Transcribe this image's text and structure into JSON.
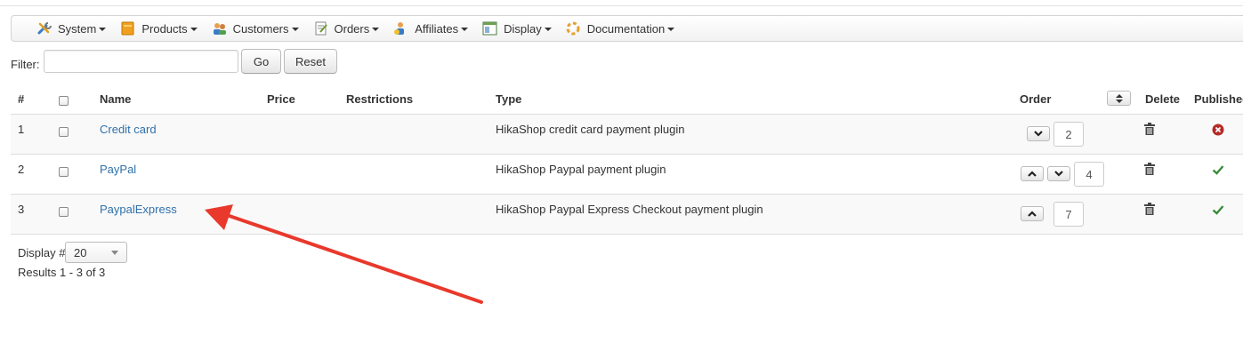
{
  "menu": {
    "items": [
      {
        "label": "System",
        "icon": "tools-icon"
      },
      {
        "label": "Products",
        "icon": "products-icon"
      },
      {
        "label": "Customers",
        "icon": "customers-icon"
      },
      {
        "label": "Orders",
        "icon": "orders-icon"
      },
      {
        "label": "Affiliates",
        "icon": "affiliates-icon"
      },
      {
        "label": "Display",
        "icon": "display-icon"
      },
      {
        "label": "Documentation",
        "icon": "documentation-icon"
      }
    ]
  },
  "filter": {
    "label": "Filter:",
    "value": "",
    "go_label": "Go",
    "reset_label": "Reset"
  },
  "table": {
    "headers": {
      "num": "#",
      "name": "Name",
      "price": "Price",
      "restrictions": "Restrictions",
      "type": "Type",
      "order": "Order",
      "delete": "Delete",
      "published": "Published"
    },
    "rows": [
      {
        "num": "1",
        "name": "Credit card",
        "price": "",
        "restrictions": "",
        "type": "HikaShop credit card payment plugin",
        "order": "2",
        "published": false,
        "up": false,
        "down": true
      },
      {
        "num": "2",
        "name": "PayPal",
        "price": "",
        "restrictions": "",
        "type": "HikaShop Paypal payment plugin",
        "order": "4",
        "published": true,
        "up": true,
        "down": true
      },
      {
        "num": "3",
        "name": "PaypalExpress",
        "price": "",
        "restrictions": "",
        "type": "HikaShop Paypal Express Checkout payment plugin",
        "order": "7",
        "published": true,
        "up": true,
        "down": false
      }
    ]
  },
  "pagination": {
    "display_label": "Display #",
    "display_value": "20",
    "results_text": "Results 1 - 3 of 3"
  },
  "colors": {
    "link": "#3071a9",
    "published_check": "#3b8c3b",
    "unpublished_x": "#b52b27",
    "annotation_arrow": "#e8392c"
  }
}
